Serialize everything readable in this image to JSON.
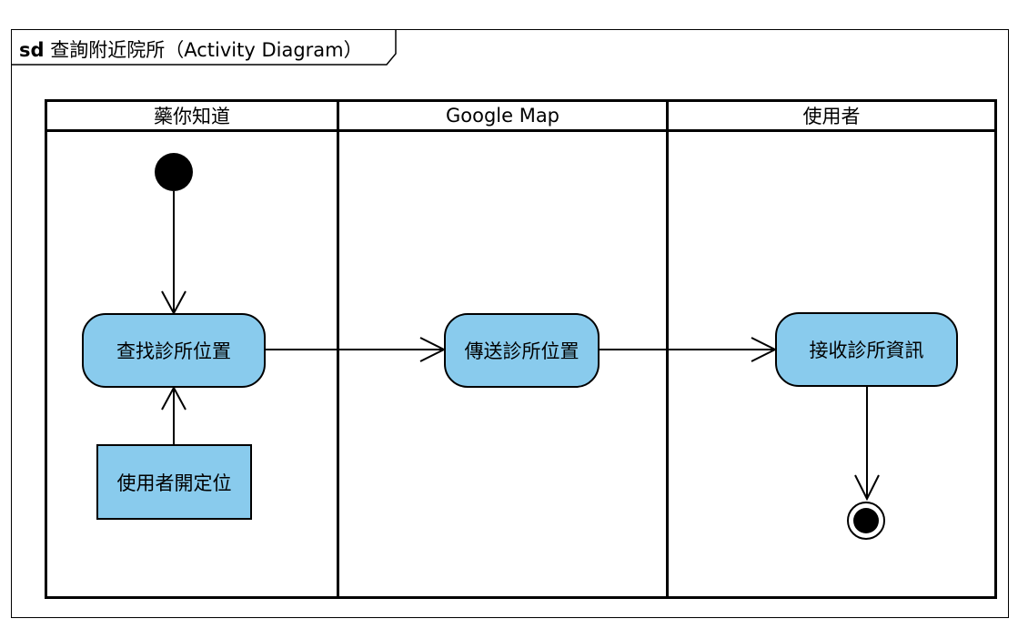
{
  "frame": {
    "keyword": "sd",
    "title": "查詢附近院所（Activity Diagram）"
  },
  "lanes": [
    {
      "label": "藥你知道"
    },
    {
      "label": "Google Map"
    },
    {
      "label": "使用者"
    }
  ],
  "activities": {
    "find_clinic_location": "查找診所位置",
    "send_clinic_location": "傳送診所位置",
    "receive_clinic_info": "接收診所資訊"
  },
  "objects": {
    "user_enable_location": "使用者開定位"
  },
  "colors": {
    "activity_fill": "#89cbed",
    "line": "#000000"
  }
}
